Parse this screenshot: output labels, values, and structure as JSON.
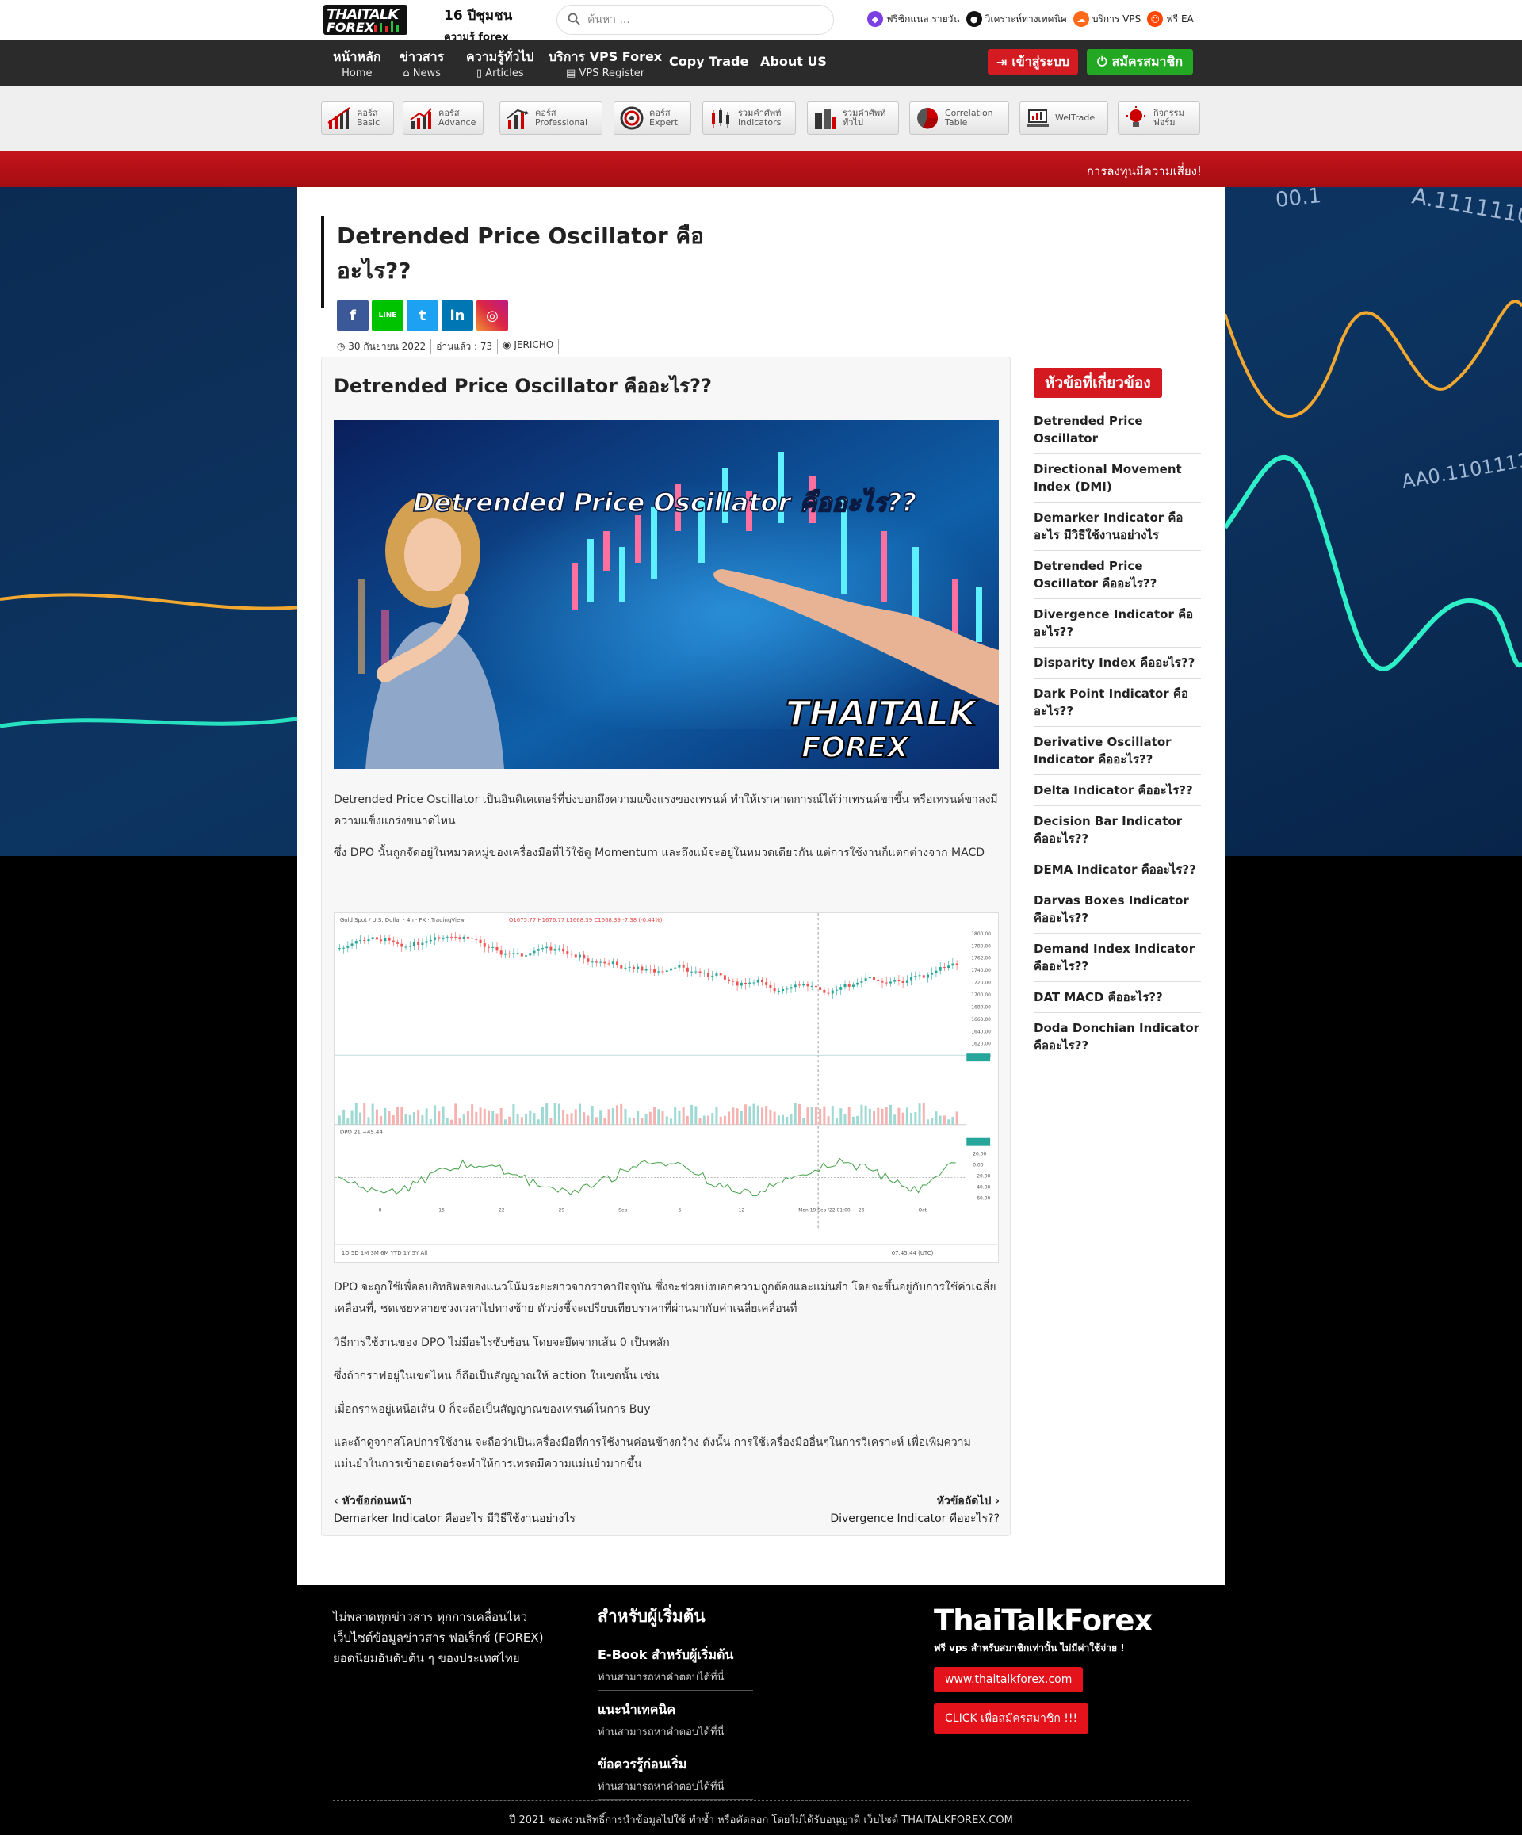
{
  "header": {
    "logo_text_1": "THAITALK",
    "logo_text_2": "FOREX",
    "slogan_1": "16 ปีชุมชน",
    "slogan_2": "ความรู้ forex",
    "search_placeholder": "ค้นหา ...",
    "top_links": [
      {
        "label": "ฟรีซิกแนล รายวัน",
        "icon": "twitch-icon",
        "color": "#7b3fe4"
      },
      {
        "label": "วิเคราะห์ทางเทคนิค",
        "icon": "chat-bubble-icon",
        "color": "#111111"
      },
      {
        "label": "บริการ VPS",
        "icon": "soundcloud-icon",
        "color": "#ff6a1a"
      },
      {
        "label": "ฟรี EA",
        "icon": "reddit-icon",
        "color": "#ff4500"
      }
    ]
  },
  "nav": {
    "items": [
      {
        "title": "หน้าหลัก",
        "sub": "Home"
      },
      {
        "title": "ข่าวสาร",
        "sub": "⌂ News"
      },
      {
        "title": "ความรู้ทั่วไป",
        "sub": "▯ Articles"
      },
      {
        "title": "บริการ VPS Forex",
        "sub": "▤ VPS Register"
      }
    ],
    "copy_trade": "Copy Trade",
    "about": "About US",
    "login": "เข้าสู่ระบบ",
    "register": "สมัครสมาชิก",
    "login_color": "#d51b22",
    "register_color": "#23a823"
  },
  "categories": [
    {
      "l1": "คอร์ส",
      "l2": "Basic"
    },
    {
      "l1": "คอร์ส",
      "l2": "Advance"
    },
    {
      "l1": "คอร์ส",
      "l2": "Professional"
    },
    {
      "l1": "คอร์ส",
      "l2": "Expert"
    },
    {
      "l1": "รวมคำศัพท์",
      "l2": "Indicators"
    },
    {
      "l1": "รวมคำศัพท์",
      "l2": "ทั่วไป"
    },
    {
      "l1": "Correlation",
      "l2": "Table"
    },
    {
      "l1": "WelTrade",
      "l2": ""
    },
    {
      "l1": "กิจกรรม",
      "l2": "ฟอร์ม"
    }
  ],
  "ticker": "การลงทุนมีความเสี่ยง!",
  "article": {
    "title": "Detrended Price Oscillator คืออะไร??",
    "share_buttons": [
      {
        "icon": "facebook-icon",
        "glyph": "f",
        "color": "#3b5998"
      },
      {
        "icon": "line-icon",
        "glyph": "LINE",
        "color": "#00c300"
      },
      {
        "icon": "twitter-icon",
        "glyph": "t",
        "color": "#1da1f2"
      },
      {
        "icon": "linkedin-icon",
        "glyph": "in",
        "color": "#0077b5"
      },
      {
        "icon": "instagram-icon",
        "glyph": "◎",
        "color": "#d6249f"
      }
    ],
    "meta": {
      "date": "◷ 30 กันยายน 2022",
      "views": "อ่านแล้ว : 73",
      "author": "◉ JERICHO"
    },
    "box_title": "Detrended Price Oscillator คืออะไร??",
    "hero": {
      "headline": "Detrended Price Oscillator คืออะไร??",
      "brand_1": "THAITALK",
      "brand_2": "FOREX"
    },
    "paragraphs_1": [
      "Detrended Price Oscillator เป็นอินดิเคเตอร์ที่บ่งบอกถึงความแข็งแรงของเทรนด์ ทำให้เราคาดการณ์ได้ว่าเทรนด์ขาขึ้น หรือเทรนด์ขาลงมีความแข็งแกร่งขนาดไหน",
      "ซึ่ง DPO นั้นถูกจัดอยู่ในหมวดหมู่ของเครื่องมือที่ไว้ใช้ดู Momentum และถึงแม้จะอยู่ในหมวดเดียวกัน แต่การใช้งานก็แตกต่างจาก MACD"
    ],
    "chart_caption": {
      "symbol": "Gold Spot / U.S. Dollar · 4h · FX · TradingView",
      "ohlc": "O1675.77 H1676.77 L1668.39 C1668.39 -7.38 (-0.44%)",
      "indicator": "DPO 21 −45.44",
      "time_axis": [
        "8",
        "15",
        "22",
        "29",
        "Sep",
        "5",
        "12",
        "Mon 19 Sep '22 01:00",
        "26",
        "Oct"
      ],
      "price_axis": [
        "1800.00",
        "1780.00",
        "1762.00",
        "1740.00",
        "1720.00",
        "1700.00",
        "1680.00",
        "1660.00",
        "1640.00",
        "1620.00",
        "1599.20"
      ],
      "dpo_axis": [
        "34.43",
        "20.00",
        "0.00",
        "−20.00",
        "−40.00",
        "−60.00"
      ],
      "range_buttons": "1D 5D 1M 3M 6M YTD 1Y 5Y All",
      "clock": "07:45:44 (UTC)"
    },
    "paragraphs_2": [
      "DPO จะถูกใช้เพื่อลบอิทธิพลของแนวโน้มระยะยาวจากราคาปัจจุบัน ซึ่งจะช่วยบ่งบอกความถูกต้องและแม่นยำ โดยจะขึ้นอยู่กับการใช้ค่าเฉลี่ยเคลื่อนที่, ชดเชยหลายช่วงเวลาไปทางซ้าย ตัวบ่งชี้จะเปรียบเทียบราคาที่ผ่านมากับค่าเฉลี่ยเคลื่อนที่",
      "วิธีการใช้งานของ DPO ไม่มีอะไรซับซ้อน โดยจะยึดจากเส้น 0 เป็นหลัก",
      "ซึ่งถ้ากราฟอยู่ในเขตไหน ก็ถือเป็นสัญญาณให้ action ในเขตนั้น เช่น",
      "เมื่อกราฟอยู่เหนือเส้น 0 ก็จะถือเป็นสัญญาณของเทรนด์ในการ Buy",
      "และถ้าดูจากสโคปการใช้งาน จะถือว่าเป็นเครื่องมือที่การใช้งานค่อนข้างกว้าง ดังนั้น การใช้เครื่องมืออื่นๆในการวิเคราะห์ เพื่อเพิ่มความแม่นยำในการเข้าออเดอร์จะทำให้การเทรดมีความแม่นยำมากขึ้น"
    ],
    "prev_label": "หัวข้อก่อนหน้า",
    "prev_title": "Demarker Indicator คืออะไร มีวิธีใช้งานอย่างไร",
    "next_label": "หัวข้อถัดไป",
    "next_title": "Divergence Indicator คืออะไร??"
  },
  "sidebar": {
    "heading": "หัวข้อที่เกี่ยวข้อง",
    "items": [
      "Detrended Price Oscillator",
      "Directional Movement Index (DMI)",
      "Demarker Indicator คืออะไร มีวิธีใช้งานอย่างไร",
      "Detrended Price Oscillator คืออะไร??",
      "Divergence Indicator คืออะไร??",
      "Disparity Index คืออะไร??",
      "Dark Point Indicator คืออะไร??",
      "Derivative Oscillator Indicator คืออะไร??",
      "Delta Indicator คืออะไร??",
      "Decision Bar Indicator คืออะไร??",
      "DEMA Indicator คืออะไร??",
      "Darvas Boxes Indicator คืออะไร??",
      "Demand Index Indicator คืออะไร??",
      "DAT MACD คืออะไร??",
      "Doda Donchian Indicator คืออะไร??"
    ]
  },
  "footer": {
    "about": "ไม่พลาดทุกข่าวสาร ทุกการเคลื่อนไหว เว็บไซต์ข้อมูลข่าวสาร ฟอเร็กซ์ (FOREX) ยอดนิยมอันดับต้น ๆ ของประเทศไทย",
    "beginner_heading": "สำหรับผู้เริ่มต้น",
    "beginner_items": [
      {
        "title": "E-Book สำหรับผู้เริ่มต้น",
        "sub": "ท่านสามารถหาคำตอบได้ที่นี่"
      },
      {
        "title": "แนะนำเทคนิค",
        "sub": "ท่านสามารถหาคำตอบได้ที่นี่"
      },
      {
        "title": "ข้อควรรู้ก่อนเริ่ม",
        "sub": "ท่านสามารถหาคำตอบได้ที่นี่"
      }
    ],
    "brand": "ThaiTalkForex",
    "tagline": "ฟรี vps สำหรับสมาชิกเท่านั้น ไม่มีค่าใช้จ่าย !",
    "site_button": "www.thaitalkforex.com",
    "register_button": "CLICK เพื่อสมัครสมาชิก !!!",
    "copyright": "ปี 2021 ขอสงวนสิทธิ์การนำข้อมูลไปใช้ ทำซ้ำ หรือคัดลอก โดยไม่ได้รับอนุญาติ เว็บไซต์ THAITALKFOREX.COM"
  }
}
